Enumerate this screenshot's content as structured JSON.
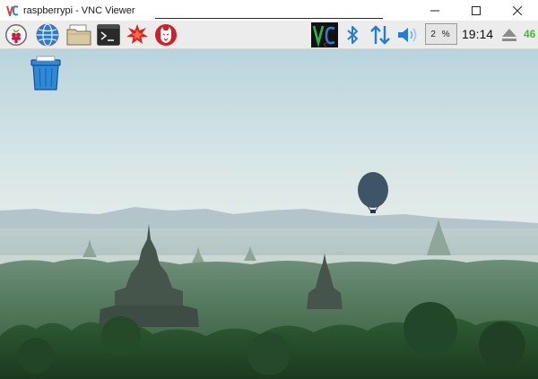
{
  "window": {
    "title": "raspberrypi - VNC Viewer",
    "app_icon": "vnc-logo-icon",
    "controls": [
      "minimize-icon",
      "maximize-icon",
      "close-icon"
    ]
  },
  "taskbar": {
    "launchers": [
      {
        "name": "raspberry-menu-icon"
      },
      {
        "name": "web-browser-icon"
      },
      {
        "name": "file-manager-icon"
      },
      {
        "name": "terminal-icon"
      },
      {
        "name": "mathematica-icon"
      },
      {
        "name": "wolfram-icon"
      }
    ],
    "tray": {
      "vnc_icon": "vnc-server-icon",
      "bluetooth_icon": "bluetooth-icon",
      "network_icon": "network-transfer-icon",
      "volume_icon": "volume-icon",
      "cpu_usage": "2 %",
      "clock": "19:14",
      "eject_icon": "eject-icon",
      "battery": "46"
    }
  },
  "desktop": {
    "icons": [
      {
        "name": "trash-icon"
      }
    ],
    "wallpaper": "misty-temples-with-hot-air-balloon"
  },
  "colors": {
    "taskbar_bg": "#ececec",
    "accent_blue": "#1e7fd6",
    "battery_green": "#3fbf2a",
    "trash_blue": "#2c8ad8"
  }
}
